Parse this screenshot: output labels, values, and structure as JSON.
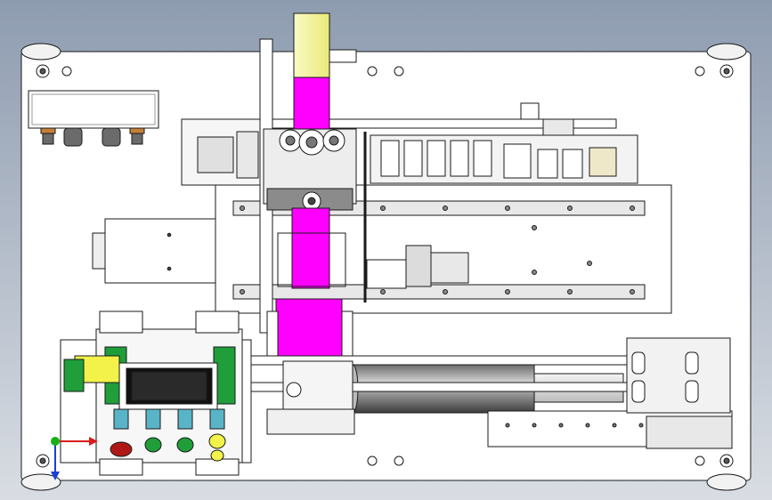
{
  "scene": {
    "background_top": "#8e9cb0",
    "background_bottom": "#d9dde3",
    "plate_color": "#ffffff",
    "line_color": "#1a1a1a",
    "accent_magenta": "#ff00ff",
    "accent_yellow": "#f2f28a",
    "accent_green": "#1f9e3a",
    "accent_cyan": "#5ab4c8",
    "button_red": "#b01818",
    "axis_x_color": "#d81b1b",
    "axis_y_color": "#1b3fd8",
    "axis_z_color": "#19b019"
  },
  "viewport": {
    "triad": {
      "x": "x-axis",
      "y": "y-axis",
      "z": "z-axis"
    }
  }
}
